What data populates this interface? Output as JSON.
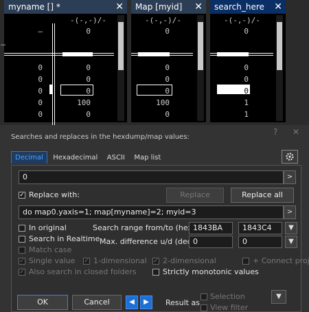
{
  "panes": [
    {
      "title": "myname [] *",
      "header": "-(-,-)/-",
      "row0": [
        "–",
        "0"
      ],
      "row1": [
        "–"
      ],
      "rows": [
        [
          "0",
          "0"
        ],
        [
          "0",
          "0"
        ],
        [
          "0",
          "0"
        ],
        [
          "0",
          "100"
        ],
        [
          "0",
          "0"
        ]
      ]
    },
    {
      "title": "Map [myid]",
      "header": "-(-,-)/-",
      "row0": [
        "0"
      ],
      "rows": [
        [
          "0"
        ],
        [
          "0"
        ],
        [
          "0"
        ],
        [
          "100"
        ],
        [
          "0"
        ]
      ]
    },
    {
      "title": "search_here",
      "header": "-(-,-)/-",
      "row0": [
        "0"
      ],
      "rows": [
        [
          "0"
        ],
        [
          "0"
        ],
        [
          "0"
        ],
        [
          "1"
        ],
        [
          "1"
        ]
      ]
    }
  ],
  "close_glyph": "✕",
  "dialog": {
    "title": "Searches and replaces in the hexdump/map values:",
    "help": "?",
    "close": "✕",
    "tabs": [
      "Decimal",
      "Hexadecimal",
      "ASCII",
      "Map list"
    ],
    "search_value": "0",
    "replace_with_label": "Replace with:",
    "replace_label": "Replace",
    "replace_all_label": "Replace all",
    "replace_value": "do map0.yaxis=1; map[myname]=2; myid=3",
    "in_original": "In original",
    "search_realtime": "Search in Realtime",
    "match_case": "Match case",
    "single_value": "Single value",
    "one_dim": "1-dimensional",
    "two_dim": "2-dimensional",
    "connect_project": "+ Connect project",
    "closed_folders": "Also search in closed folders",
    "strictly_monotonic": "Strictly monotonic values",
    "range_label": "Search range from/to (hex)",
    "range_from": "1843BA",
    "range_to": "1843C4",
    "maxdiff_label": "Max. difference u/d (dec)",
    "maxdiff_u": "0",
    "maxdiff_d": "0",
    "ok": "OK",
    "cancel": "Cancel",
    "result_as": "Result as",
    "selection": "Selection",
    "view_filter": "View filter",
    "check_mark": "✓",
    "arrow_right": ">",
    "arrow_prev": "◀",
    "arrow_next": "▶",
    "dropdown": "▼"
  }
}
